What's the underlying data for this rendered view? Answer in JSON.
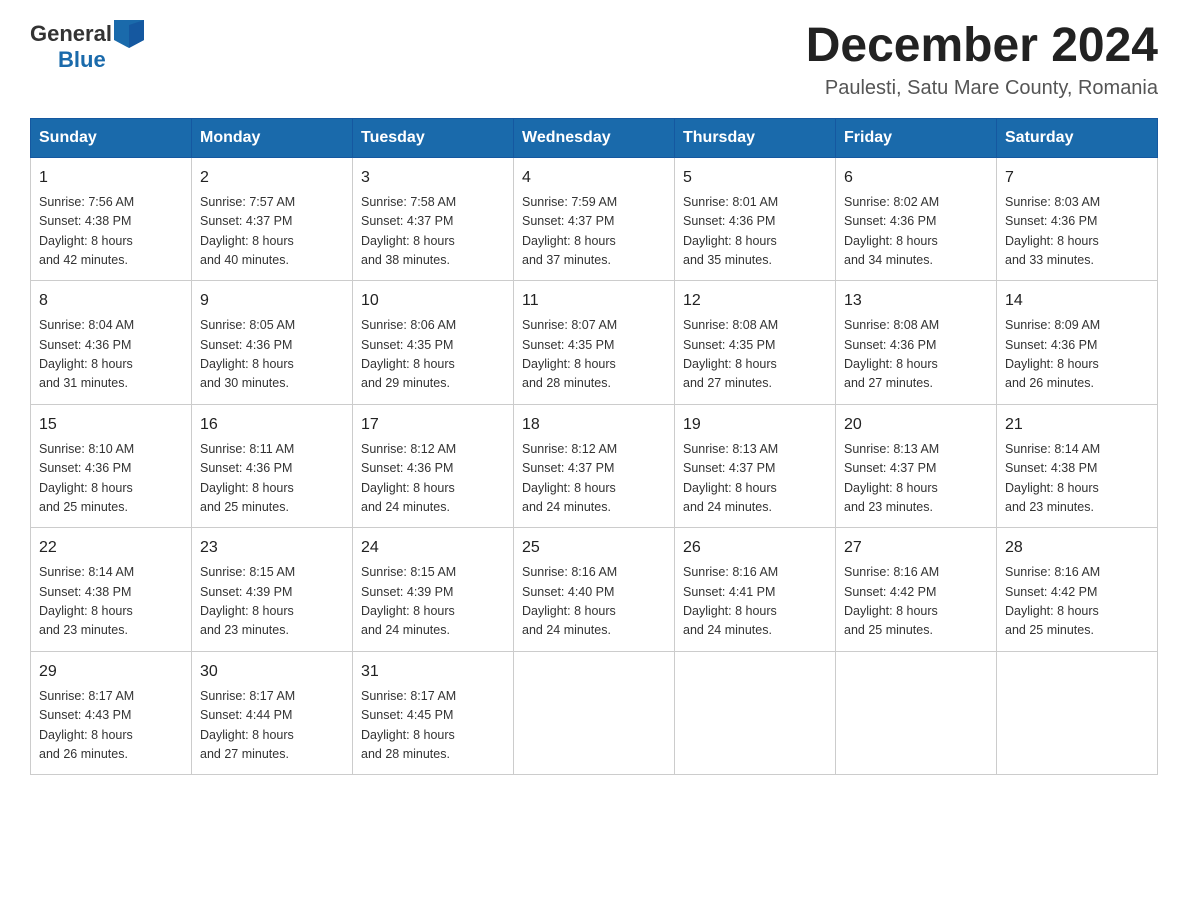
{
  "header": {
    "logo_general": "General",
    "logo_blue": "Blue",
    "title": "December 2024",
    "location": "Paulesti, Satu Mare County, Romania"
  },
  "days_of_week": [
    "Sunday",
    "Monday",
    "Tuesday",
    "Wednesday",
    "Thursday",
    "Friday",
    "Saturday"
  ],
  "weeks": [
    [
      {
        "day": "1",
        "sunrise": "7:56 AM",
        "sunset": "4:38 PM",
        "daylight": "8 hours and 42 minutes."
      },
      {
        "day": "2",
        "sunrise": "7:57 AM",
        "sunset": "4:37 PM",
        "daylight": "8 hours and 40 minutes."
      },
      {
        "day": "3",
        "sunrise": "7:58 AM",
        "sunset": "4:37 PM",
        "daylight": "8 hours and 38 minutes."
      },
      {
        "day": "4",
        "sunrise": "7:59 AM",
        "sunset": "4:37 PM",
        "daylight": "8 hours and 37 minutes."
      },
      {
        "day": "5",
        "sunrise": "8:01 AM",
        "sunset": "4:36 PM",
        "daylight": "8 hours and 35 minutes."
      },
      {
        "day": "6",
        "sunrise": "8:02 AM",
        "sunset": "4:36 PM",
        "daylight": "8 hours and 34 minutes."
      },
      {
        "day": "7",
        "sunrise": "8:03 AM",
        "sunset": "4:36 PM",
        "daylight": "8 hours and 33 minutes."
      }
    ],
    [
      {
        "day": "8",
        "sunrise": "8:04 AM",
        "sunset": "4:36 PM",
        "daylight": "8 hours and 31 minutes."
      },
      {
        "day": "9",
        "sunrise": "8:05 AM",
        "sunset": "4:36 PM",
        "daylight": "8 hours and 30 minutes."
      },
      {
        "day": "10",
        "sunrise": "8:06 AM",
        "sunset": "4:35 PM",
        "daylight": "8 hours and 29 minutes."
      },
      {
        "day": "11",
        "sunrise": "8:07 AM",
        "sunset": "4:35 PM",
        "daylight": "8 hours and 28 minutes."
      },
      {
        "day": "12",
        "sunrise": "8:08 AM",
        "sunset": "4:35 PM",
        "daylight": "8 hours and 27 minutes."
      },
      {
        "day": "13",
        "sunrise": "8:08 AM",
        "sunset": "4:36 PM",
        "daylight": "8 hours and 27 minutes."
      },
      {
        "day": "14",
        "sunrise": "8:09 AM",
        "sunset": "4:36 PM",
        "daylight": "8 hours and 26 minutes."
      }
    ],
    [
      {
        "day": "15",
        "sunrise": "8:10 AM",
        "sunset": "4:36 PM",
        "daylight": "8 hours and 25 minutes."
      },
      {
        "day": "16",
        "sunrise": "8:11 AM",
        "sunset": "4:36 PM",
        "daylight": "8 hours and 25 minutes."
      },
      {
        "day": "17",
        "sunrise": "8:12 AM",
        "sunset": "4:36 PM",
        "daylight": "8 hours and 24 minutes."
      },
      {
        "day": "18",
        "sunrise": "8:12 AM",
        "sunset": "4:37 PM",
        "daylight": "8 hours and 24 minutes."
      },
      {
        "day": "19",
        "sunrise": "8:13 AM",
        "sunset": "4:37 PM",
        "daylight": "8 hours and 24 minutes."
      },
      {
        "day": "20",
        "sunrise": "8:13 AM",
        "sunset": "4:37 PM",
        "daylight": "8 hours and 23 minutes."
      },
      {
        "day": "21",
        "sunrise": "8:14 AM",
        "sunset": "4:38 PM",
        "daylight": "8 hours and 23 minutes."
      }
    ],
    [
      {
        "day": "22",
        "sunrise": "8:14 AM",
        "sunset": "4:38 PM",
        "daylight": "8 hours and 23 minutes."
      },
      {
        "day": "23",
        "sunrise": "8:15 AM",
        "sunset": "4:39 PM",
        "daylight": "8 hours and 23 minutes."
      },
      {
        "day": "24",
        "sunrise": "8:15 AM",
        "sunset": "4:39 PM",
        "daylight": "8 hours and 24 minutes."
      },
      {
        "day": "25",
        "sunrise": "8:16 AM",
        "sunset": "4:40 PM",
        "daylight": "8 hours and 24 minutes."
      },
      {
        "day": "26",
        "sunrise": "8:16 AM",
        "sunset": "4:41 PM",
        "daylight": "8 hours and 24 minutes."
      },
      {
        "day": "27",
        "sunrise": "8:16 AM",
        "sunset": "4:42 PM",
        "daylight": "8 hours and 25 minutes."
      },
      {
        "day": "28",
        "sunrise": "8:16 AM",
        "sunset": "4:42 PM",
        "daylight": "8 hours and 25 minutes."
      }
    ],
    [
      {
        "day": "29",
        "sunrise": "8:17 AM",
        "sunset": "4:43 PM",
        "daylight": "8 hours and 26 minutes."
      },
      {
        "day": "30",
        "sunrise": "8:17 AM",
        "sunset": "4:44 PM",
        "daylight": "8 hours and 27 minutes."
      },
      {
        "day": "31",
        "sunrise": "8:17 AM",
        "sunset": "4:45 PM",
        "daylight": "8 hours and 28 minutes."
      },
      null,
      null,
      null,
      null
    ]
  ],
  "labels": {
    "sunrise": "Sunrise:",
    "sunset": "Sunset:",
    "daylight": "Daylight:"
  }
}
